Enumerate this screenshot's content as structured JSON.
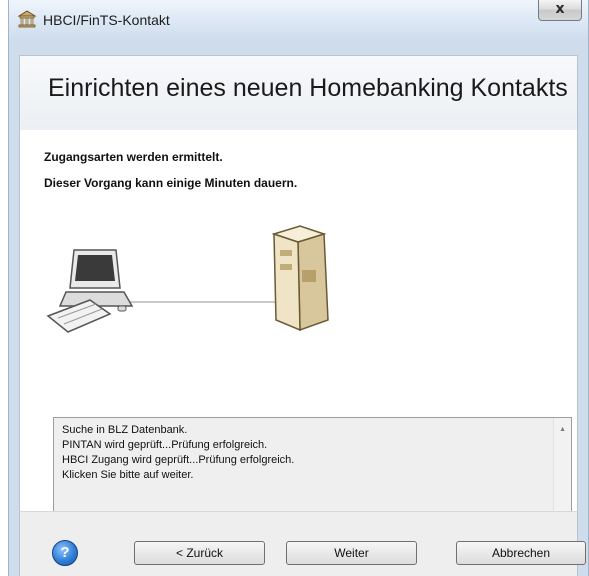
{
  "window": {
    "title": "HBCI/FinTS-Kontakt",
    "close_glyph": "x"
  },
  "header": {
    "title": "Einrichten eines neuen Homebanking Kontakts"
  },
  "messages": {
    "line1": "Zugangsarten werden ermittelt.",
    "line2": "Dieser Vorgang kann einige Minuten dauern."
  },
  "illustration": {
    "left_icon": "computer-icon",
    "right_icon": "server-icon"
  },
  "log": {
    "lines": [
      "Suche in BLZ Datenbank.",
      "PINTAN wird geprüft...Prüfung erfolgreich.",
      "HBCI Zugang wird geprüft...Prüfung erfolgreich.",
      "Klicken Sie bitte auf weiter."
    ]
  },
  "footer": {
    "help_icon": "help-icon",
    "help_glyph": "?",
    "back_label": "< Zurück",
    "next_label": "Weiter",
    "cancel_label": "Abbrechen"
  }
}
